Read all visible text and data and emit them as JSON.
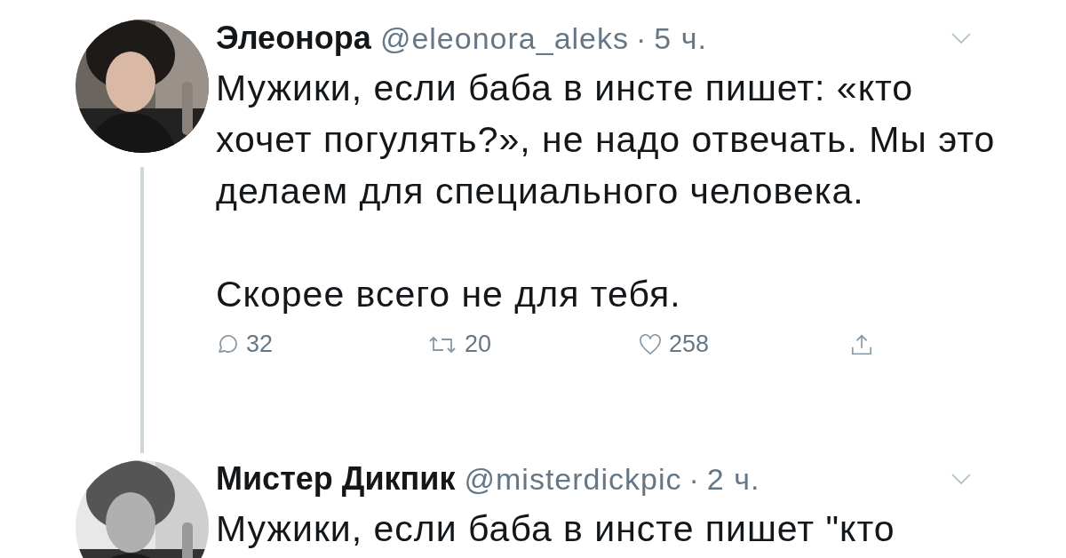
{
  "tweets": [
    {
      "name": "Элеонора",
      "handle": "@eleonora_aleks",
      "separator": "·",
      "time": "5 ч.",
      "thread_line": true,
      "paragraphs": [
        "Мужики, если баба в инсте пишет: «кто хочет погулять?», не надо отвечать. Мы это делаем для специального человека.",
        "Скорее всего не для тебя."
      ],
      "actions": [
        {
          "kind": "reply",
          "count": "32"
        },
        {
          "kind": "retweet",
          "count": "20"
        },
        {
          "kind": "like",
          "count": "258"
        },
        {
          "kind": "share"
        }
      ]
    },
    {
      "name": "Мистер Дикпик",
      "handle": "@misterdickpic",
      "separator": "·",
      "time": "2 ч.",
      "paragraphs": [
        "Мужики, если баба в инсте пишет \"кто"
      ]
    }
  ]
}
